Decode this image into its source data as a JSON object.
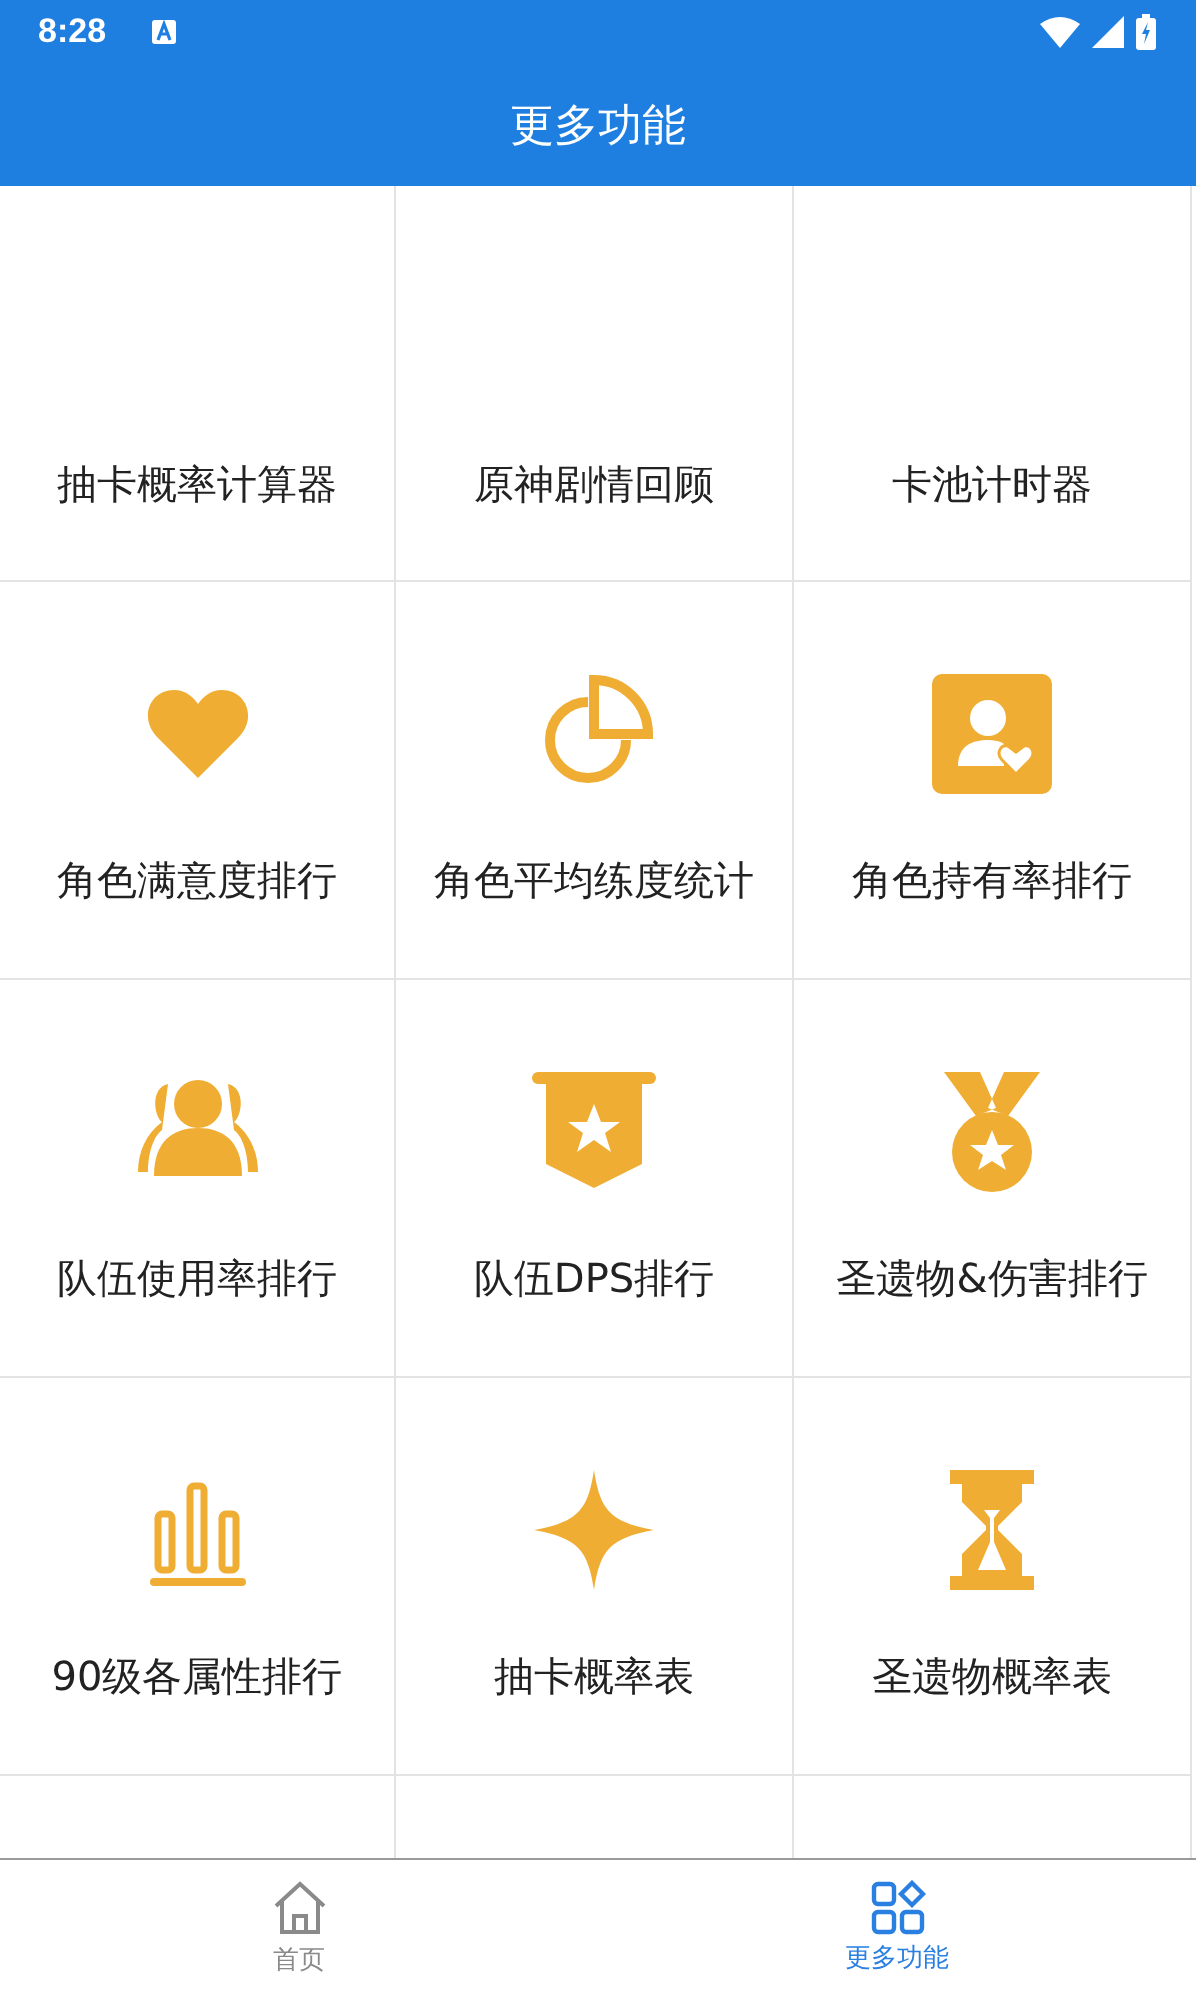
{
  "status_bar": {
    "time": "8:28"
  },
  "app_bar": {
    "title": "更多功能"
  },
  "features": [
    {
      "label": "抽卡概率计算器",
      "kind": "blank"
    },
    {
      "label": "原神剧情回顾",
      "kind": "blank"
    },
    {
      "label": "卡池计时器",
      "kind": "blank"
    },
    {
      "label": "角色满意度排行",
      "kind": "heart"
    },
    {
      "label": "角色平均练度统计",
      "kind": "pie"
    },
    {
      "label": "角色持有率排行",
      "kind": "profile"
    },
    {
      "label": "队伍使用率排行",
      "kind": "group"
    },
    {
      "label": "队伍DPS排行",
      "kind": "banner"
    },
    {
      "label": "圣遗物&伤害排行",
      "kind": "medal"
    },
    {
      "label": "90级各属性排行",
      "kind": "bars"
    },
    {
      "label": "抽卡概率表",
      "kind": "sparkle"
    },
    {
      "label": "圣遗物概率表",
      "kind": "hourglass"
    }
  ],
  "bottom_nav": [
    {
      "label": "首页",
      "kind": "home",
      "selected": false
    },
    {
      "label": "更多功能",
      "kind": "apps",
      "selected": true
    }
  ]
}
